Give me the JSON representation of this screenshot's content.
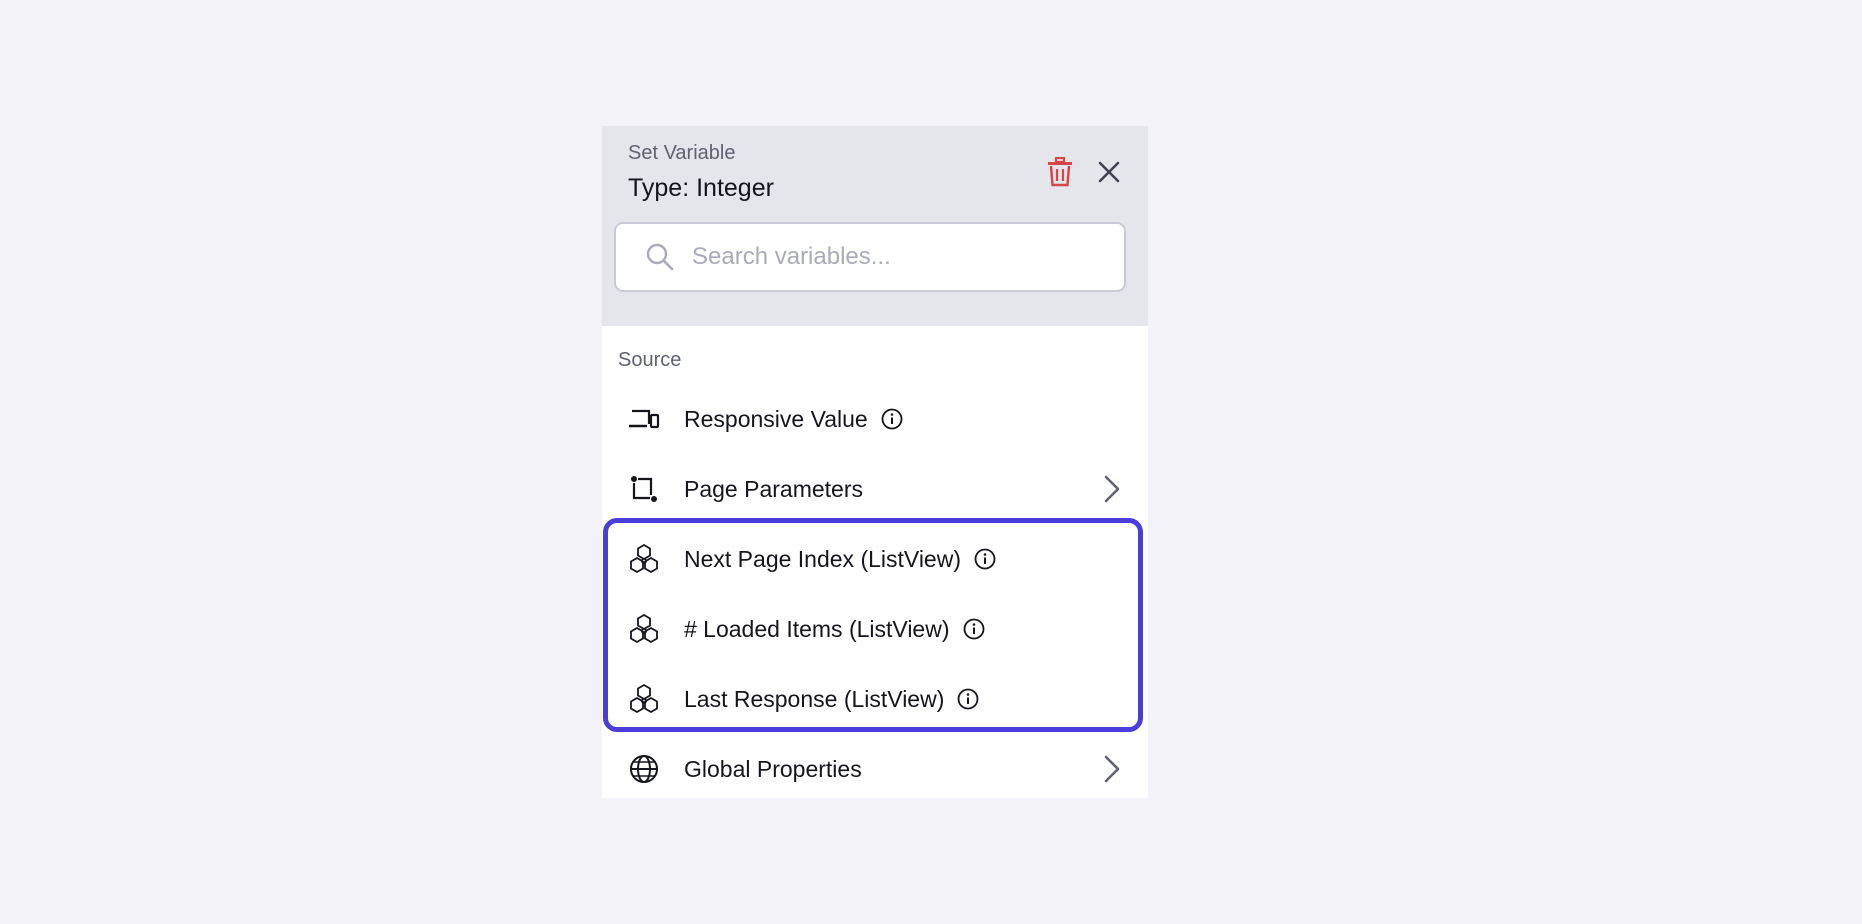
{
  "header": {
    "subtitle": "Set Variable",
    "title": "Type: Integer"
  },
  "search": {
    "placeholder": "Search variables...",
    "value": ""
  },
  "section": {
    "label": "Source"
  },
  "items": [
    {
      "label": "Responsive Value",
      "icon": "devices-icon",
      "info": true,
      "chevron": false
    },
    {
      "label": "Page Parameters",
      "icon": "page-parameters-icon",
      "info": false,
      "chevron": true
    },
    {
      "label": "Next Page Index (ListView)",
      "icon": "listview-component-icon",
      "info": true,
      "chevron": false
    },
    {
      "label": "# Loaded Items (ListView)",
      "icon": "listview-component-icon",
      "info": true,
      "chevron": false
    },
    {
      "label": "Last Response (ListView)",
      "icon": "listview-component-icon",
      "info": true,
      "chevron": false
    },
    {
      "label": "Global Properties",
      "icon": "globe-icon",
      "info": false,
      "chevron": true
    }
  ],
  "colors": {
    "accent": "#4b3ddb",
    "delete": "#d64545",
    "header_bg": "#e5e5ec",
    "page_bg": "#f3f2f8"
  }
}
